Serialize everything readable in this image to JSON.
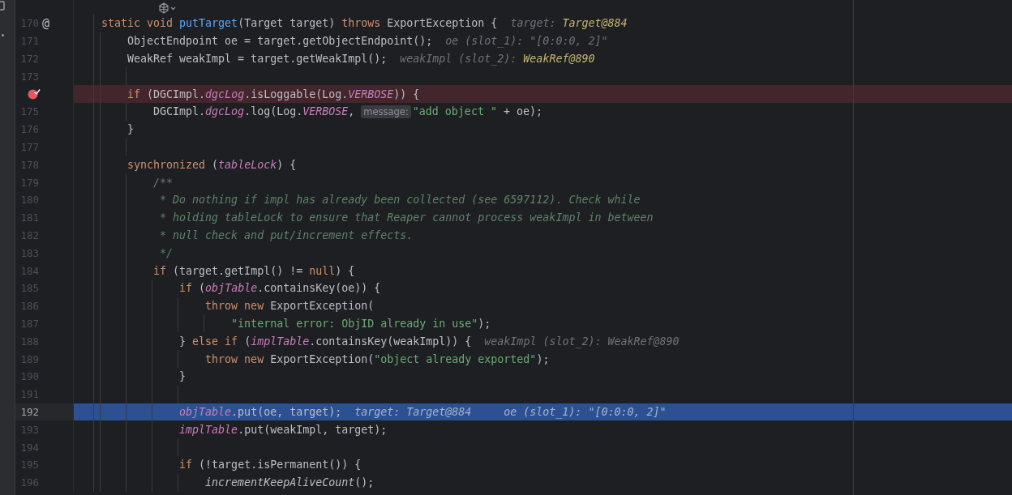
{
  "editor": {
    "lines": [
      {
        "number": "170",
        "gutter_mark": "@",
        "breakpoint": false,
        "current": false,
        "segments": [
          {
            "kind": "code",
            "tokens": [
              {
                "text": "static void ",
                "kind": "keyword"
              },
              {
                "text": "putTarget",
                "kind": "method"
              },
              {
                "text": "(Target target) ",
                "kind": "plain"
              },
              {
                "text": "throws ",
                "kind": "keyword"
              },
              {
                "text": "ExportException {",
                "kind": "plain"
              }
            ]
          },
          {
            "kind": "value_hint",
            "label": "target:",
            "value": "Target@884",
            "emphasized": true
          }
        ]
      },
      {
        "number": "171",
        "breakpoint": false,
        "current": false,
        "segments": [
          {
            "kind": "code",
            "tokens": [
              {
                "text": "    ObjectEndpoint oe = target.getObjectEndpoint();",
                "kind": "plain"
              }
            ]
          },
          {
            "kind": "value_hint",
            "label": "oe (slot_1):",
            "value": "\"[0:0:0, 2]\"",
            "emphasized": false
          }
        ]
      },
      {
        "number": "172",
        "breakpoint": false,
        "current": false,
        "segments": [
          {
            "kind": "code",
            "tokens": [
              {
                "text": "    WeakRef weakImpl = target.getWeakImpl();",
                "kind": "plain"
              }
            ]
          },
          {
            "kind": "value_hint",
            "label": "weakImpl (slot_2):",
            "value": "WeakRef@890",
            "emphasized": true
          }
        ]
      },
      {
        "number": "173",
        "breakpoint": false,
        "current": false
      },
      {
        "breakpoint": true,
        "current": false,
        "segments": [
          {
            "kind": "code",
            "tokens": [
              {
                "text": "    if ",
                "kind": "keyword"
              },
              {
                "text": "(DGCImpl.",
                "kind": "plain"
              },
              {
                "text": "dgcLog",
                "kind": "field"
              },
              {
                "text": ".isLoggable(Log.",
                "kind": "plain"
              },
              {
                "text": "VERBOSE",
                "kind": "field"
              },
              {
                "text": ")) {",
                "kind": "plain"
              }
            ]
          }
        ]
      },
      {
        "number": "175",
        "breakpoint": false,
        "current": false,
        "segments": [
          {
            "kind": "code",
            "tokens": [
              {
                "text": "        DGCImpl.",
                "kind": "plain"
              },
              {
                "text": "dgcLog",
                "kind": "field"
              },
              {
                "text": ".log(Log.",
                "kind": "plain"
              },
              {
                "text": "VERBOSE",
                "kind": "field"
              },
              {
                "text": ", ",
                "kind": "plain"
              }
            ]
          },
          {
            "kind": "param_hint",
            "label": "message:"
          },
          {
            "kind": "code",
            "tokens": [
              {
                "text": "\"add object \"",
                "kind": "string"
              },
              {
                "text": " + oe);",
                "kind": "plain"
              }
            ]
          }
        ]
      },
      {
        "number": "176",
        "breakpoint": false,
        "current": false,
        "segments": [
          {
            "kind": "code",
            "tokens": [
              {
                "text": "    }",
                "kind": "plain"
              }
            ]
          }
        ]
      },
      {
        "number": "177",
        "breakpoint": false,
        "current": false
      },
      {
        "number": "178",
        "breakpoint": false,
        "current": false,
        "segments": [
          {
            "kind": "code",
            "tokens": [
              {
                "text": "    synchronized ",
                "kind": "keyword"
              },
              {
                "text": "(",
                "kind": "plain"
              },
              {
                "text": "tableLock",
                "kind": "field"
              },
              {
                "text": ") {",
                "kind": "plain"
              }
            ]
          }
        ]
      },
      {
        "number": "179",
        "breakpoint": false,
        "current": false,
        "segments": [
          {
            "kind": "code",
            "tokens": [
              {
                "text": "        /**",
                "kind": "comment"
              }
            ]
          }
        ]
      },
      {
        "number": "180",
        "breakpoint": false,
        "current": false,
        "segments": [
          {
            "kind": "code",
            "tokens": [
              {
                "text": "         * Do nothing if impl has already been collected (see 6597112). Check while",
                "kind": "comment"
              }
            ]
          }
        ]
      },
      {
        "number": "181",
        "breakpoint": false,
        "current": false,
        "segments": [
          {
            "kind": "code",
            "tokens": [
              {
                "text": "         * holding tableLock to ensure that Reaper cannot process weakImpl in between",
                "kind": "comment"
              }
            ]
          }
        ]
      },
      {
        "number": "182",
        "breakpoint": false,
        "current": false,
        "segments": [
          {
            "kind": "code",
            "tokens": [
              {
                "text": "         * null check and put/increment effects.",
                "kind": "comment"
              }
            ]
          }
        ]
      },
      {
        "number": "183",
        "breakpoint": false,
        "current": false,
        "segments": [
          {
            "kind": "code",
            "tokens": [
              {
                "text": "         */",
                "kind": "comment"
              }
            ]
          }
        ]
      },
      {
        "number": "184",
        "breakpoint": false,
        "current": false,
        "segments": [
          {
            "kind": "code",
            "tokens": [
              {
                "text": "        if ",
                "kind": "keyword"
              },
              {
                "text": "(target.getImpl() != ",
                "kind": "plain"
              },
              {
                "text": "null",
                "kind": "keyword"
              },
              {
                "text": ") {",
                "kind": "plain"
              }
            ]
          }
        ]
      },
      {
        "number": "185",
        "breakpoint": false,
        "current": false,
        "segments": [
          {
            "kind": "code",
            "tokens": [
              {
                "text": "            if ",
                "kind": "keyword"
              },
              {
                "text": "(",
                "kind": "plain"
              },
              {
                "text": "objTable",
                "kind": "field"
              },
              {
                "text": ".containsKey(oe)) {",
                "kind": "plain"
              }
            ]
          }
        ]
      },
      {
        "number": "186",
        "breakpoint": false,
        "current": false,
        "segments": [
          {
            "kind": "code",
            "tokens": [
              {
                "text": "                throw new ",
                "kind": "keyword"
              },
              {
                "text": "ExportException(",
                "kind": "plain"
              }
            ]
          }
        ]
      },
      {
        "number": "187",
        "breakpoint": false,
        "current": false,
        "segments": [
          {
            "kind": "code",
            "tokens": [
              {
                "text": "                    \"internal error: ObjID already in use\"",
                "kind": "string"
              },
              {
                "text": ");",
                "kind": "plain"
              }
            ]
          }
        ]
      },
      {
        "number": "188",
        "breakpoint": false,
        "current": false,
        "segments": [
          {
            "kind": "code",
            "tokens": [
              {
                "text": "            } ",
                "kind": "plain"
              },
              {
                "text": "else if ",
                "kind": "keyword"
              },
              {
                "text": "(",
                "kind": "plain"
              },
              {
                "text": "implTable",
                "kind": "field"
              },
              {
                "text": ".containsKey(weakImpl)) {",
                "kind": "plain"
              }
            ]
          },
          {
            "kind": "value_hint",
            "label": "weakImpl (slot_2):",
            "value": "WeakRef@890",
            "emphasized": false
          }
        ]
      },
      {
        "number": "189",
        "breakpoint": false,
        "current": false,
        "segments": [
          {
            "kind": "code",
            "tokens": [
              {
                "text": "                throw new ",
                "kind": "keyword"
              },
              {
                "text": "ExportException(",
                "kind": "plain"
              },
              {
                "text": "\"object already exported\"",
                "kind": "string"
              },
              {
                "text": ");",
                "kind": "plain"
              }
            ]
          }
        ]
      },
      {
        "number": "190",
        "breakpoint": false,
        "current": false,
        "segments": [
          {
            "kind": "code",
            "tokens": [
              {
                "text": "            }",
                "kind": "plain"
              }
            ]
          }
        ]
      },
      {
        "number": "191",
        "breakpoint": false,
        "current": false
      },
      {
        "number": "192",
        "breakpoint": false,
        "current": true,
        "segments": [
          {
            "kind": "code",
            "tokens": [
              {
                "text": "            objTable",
                "kind": "field"
              },
              {
                "text": ".put(oe, target);",
                "kind": "plain"
              }
            ]
          },
          {
            "kind": "value_hint",
            "label": "target:",
            "value": "Target@884",
            "emphasized": false
          },
          {
            "kind": "value_hint",
            "label": "oe (slot_1):",
            "value": "\"[0:0:0, 2]\"",
            "emphasized": false
          }
        ]
      },
      {
        "number": "193",
        "breakpoint": false,
        "current": false,
        "segments": [
          {
            "kind": "code",
            "tokens": [
              {
                "text": "            implTable",
                "kind": "field"
              },
              {
                "text": ".put(weakImpl, target);",
                "kind": "plain"
              }
            ]
          }
        ]
      },
      {
        "number": "194",
        "breakpoint": false,
        "current": false
      },
      {
        "number": "195",
        "breakpoint": false,
        "current": false,
        "segments": [
          {
            "kind": "code",
            "tokens": [
              {
                "text": "            if ",
                "kind": "keyword"
              },
              {
                "text": "(!target.isPermanent()) {",
                "kind": "plain"
              }
            ]
          }
        ]
      },
      {
        "number": "196",
        "breakpoint": false,
        "current": false,
        "segments": [
          {
            "kind": "code",
            "tokens": [
              {
                "text": "                incrementKeepAliveCount",
                "kind": "static_call"
              },
              {
                "text": "();",
                "kind": "plain"
              }
            ]
          }
        ]
      }
    ]
  }
}
